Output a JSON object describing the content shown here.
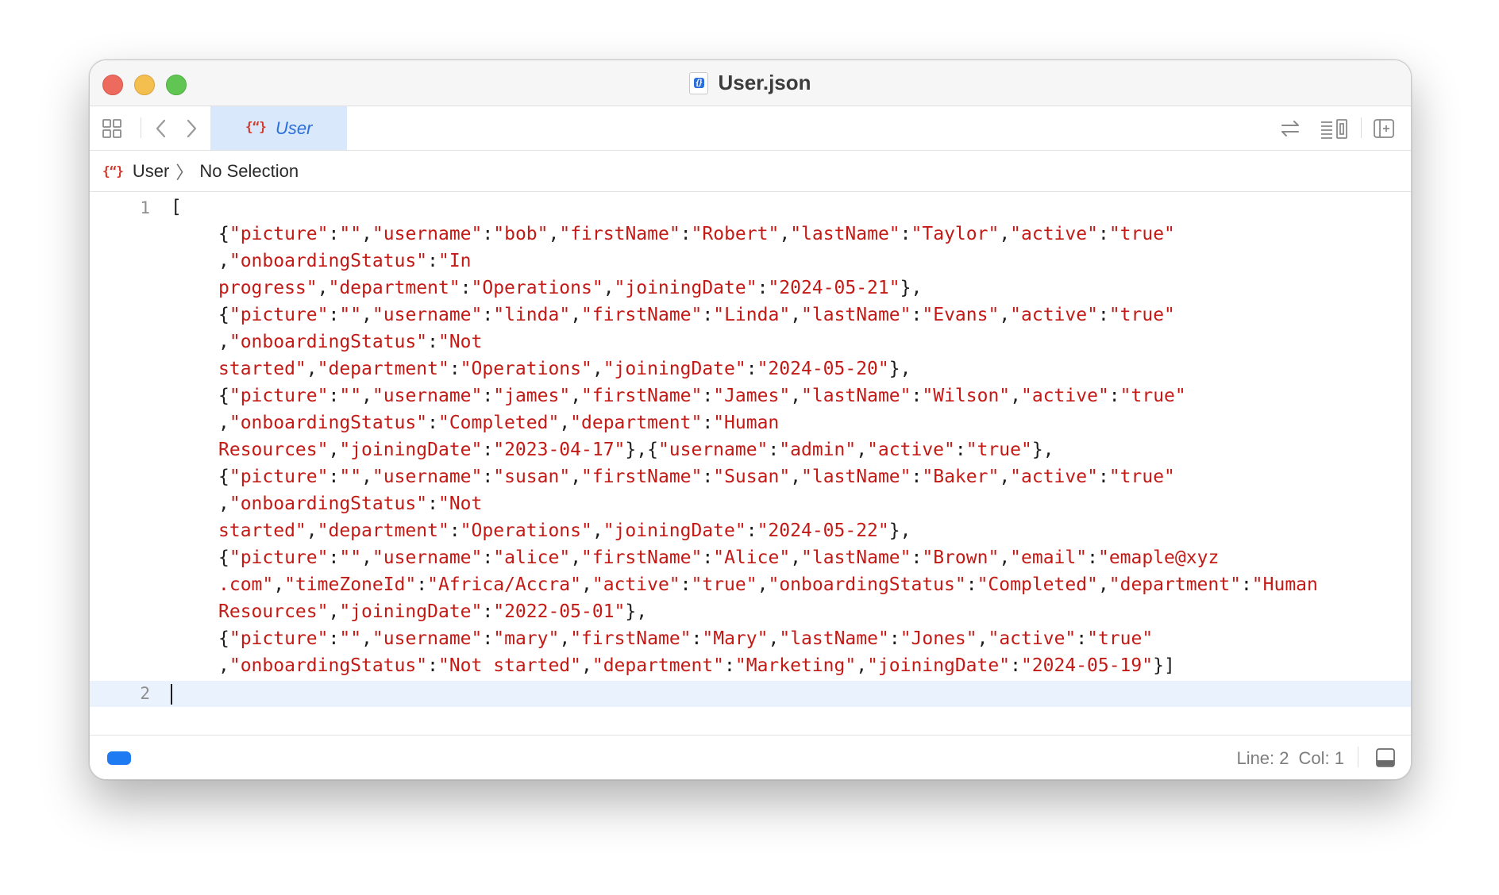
{
  "window": {
    "title": "User.json",
    "file_icon": "json-file-icon"
  },
  "toolbar": {
    "tab_label": "User",
    "tab_icon": "json-curly-icon",
    "icons": [
      "grid-icon",
      "back-arrow-icon",
      "forward-arrow-icon",
      "swap-arrows-icon",
      "minimap-icon",
      "add-editor-icon"
    ]
  },
  "jumpbar": {
    "file": "User",
    "selection": "No Selection"
  },
  "editor": {
    "line_numbers": [
      "1",
      "2"
    ],
    "lines": [
      [
        [
          "p",
          "["
        ]
      ],
      [
        [
          "p",
          "{"
        ],
        [
          "s",
          "\"picture\""
        ],
        [
          "p",
          ":"
        ],
        [
          "s",
          "\"\""
        ],
        [
          "p",
          ","
        ],
        [
          "s",
          "\"username\""
        ],
        [
          "p",
          ":"
        ],
        [
          "s",
          "\"bob\""
        ],
        [
          "p",
          ","
        ],
        [
          "s",
          "\"firstName\""
        ],
        [
          "p",
          ":"
        ],
        [
          "s",
          "\"Robert\""
        ],
        [
          "p",
          ","
        ],
        [
          "s",
          "\"lastName\""
        ],
        [
          "p",
          ":"
        ],
        [
          "s",
          "\"Taylor\""
        ],
        [
          "p",
          ","
        ],
        [
          "s",
          "\"active\""
        ],
        [
          "p",
          ":"
        ],
        [
          "s",
          "\"true\""
        ]
      ],
      [
        [
          "p",
          ","
        ],
        [
          "s",
          "\"onboardingStatus\""
        ],
        [
          "p",
          ":"
        ],
        [
          "s",
          "\"In"
        ]
      ],
      [
        [
          "s",
          "progress\""
        ],
        [
          "p",
          ","
        ],
        [
          "s",
          "\"department\""
        ],
        [
          "p",
          ":"
        ],
        [
          "s",
          "\"Operations\""
        ],
        [
          "p",
          ","
        ],
        [
          "s",
          "\"joiningDate\""
        ],
        [
          "p",
          ":"
        ],
        [
          "s",
          "\"2024-05-21\""
        ],
        [
          "p",
          "},"
        ]
      ],
      [
        [
          "p",
          "{"
        ],
        [
          "s",
          "\"picture\""
        ],
        [
          "p",
          ":"
        ],
        [
          "s",
          "\"\""
        ],
        [
          "p",
          ","
        ],
        [
          "s",
          "\"username\""
        ],
        [
          "p",
          ":"
        ],
        [
          "s",
          "\"linda\""
        ],
        [
          "p",
          ","
        ],
        [
          "s",
          "\"firstName\""
        ],
        [
          "p",
          ":"
        ],
        [
          "s",
          "\"Linda\""
        ],
        [
          "p",
          ","
        ],
        [
          "s",
          "\"lastName\""
        ],
        [
          "p",
          ":"
        ],
        [
          "s",
          "\"Evans\""
        ],
        [
          "p",
          ","
        ],
        [
          "s",
          "\"active\""
        ],
        [
          "p",
          ":"
        ],
        [
          "s",
          "\"true\""
        ]
      ],
      [
        [
          "p",
          ","
        ],
        [
          "s",
          "\"onboardingStatus\""
        ],
        [
          "p",
          ":"
        ],
        [
          "s",
          "\"Not"
        ]
      ],
      [
        [
          "s",
          "started\""
        ],
        [
          "p",
          ","
        ],
        [
          "s",
          "\"department\""
        ],
        [
          "p",
          ":"
        ],
        [
          "s",
          "\"Operations\""
        ],
        [
          "p",
          ","
        ],
        [
          "s",
          "\"joiningDate\""
        ],
        [
          "p",
          ":"
        ],
        [
          "s",
          "\"2024-05-20\""
        ],
        [
          "p",
          "},"
        ]
      ],
      [
        [
          "p",
          "{"
        ],
        [
          "s",
          "\"picture\""
        ],
        [
          "p",
          ":"
        ],
        [
          "s",
          "\"\""
        ],
        [
          "p",
          ","
        ],
        [
          "s",
          "\"username\""
        ],
        [
          "p",
          ":"
        ],
        [
          "s",
          "\"james\""
        ],
        [
          "p",
          ","
        ],
        [
          "s",
          "\"firstName\""
        ],
        [
          "p",
          ":"
        ],
        [
          "s",
          "\"James\""
        ],
        [
          "p",
          ","
        ],
        [
          "s",
          "\"lastName\""
        ],
        [
          "p",
          ":"
        ],
        [
          "s",
          "\"Wilson\""
        ],
        [
          "p",
          ","
        ],
        [
          "s",
          "\"active\""
        ],
        [
          "p",
          ":"
        ],
        [
          "s",
          "\"true\""
        ]
      ],
      [
        [
          "p",
          ","
        ],
        [
          "s",
          "\"onboardingStatus\""
        ],
        [
          "p",
          ":"
        ],
        [
          "s",
          "\"Completed\""
        ],
        [
          "p",
          ","
        ],
        [
          "s",
          "\"department\""
        ],
        [
          "p",
          ":"
        ],
        [
          "s",
          "\"Human"
        ]
      ],
      [
        [
          "s",
          "Resources\""
        ],
        [
          "p",
          ","
        ],
        [
          "s",
          "\"joiningDate\""
        ],
        [
          "p",
          ":"
        ],
        [
          "s",
          "\"2023-04-17\""
        ],
        [
          "p",
          "},{"
        ],
        [
          "s",
          "\"username\""
        ],
        [
          "p",
          ":"
        ],
        [
          "s",
          "\"admin\""
        ],
        [
          "p",
          ","
        ],
        [
          "s",
          "\"active\""
        ],
        [
          "p",
          ":"
        ],
        [
          "s",
          "\"true\""
        ],
        [
          "p",
          "},"
        ]
      ],
      [
        [
          "p",
          "{"
        ],
        [
          "s",
          "\"picture\""
        ],
        [
          "p",
          ":"
        ],
        [
          "s",
          "\"\""
        ],
        [
          "p",
          ","
        ],
        [
          "s",
          "\"username\""
        ],
        [
          "p",
          ":"
        ],
        [
          "s",
          "\"susan\""
        ],
        [
          "p",
          ","
        ],
        [
          "s",
          "\"firstName\""
        ],
        [
          "p",
          ":"
        ],
        [
          "s",
          "\"Susan\""
        ],
        [
          "p",
          ","
        ],
        [
          "s",
          "\"lastName\""
        ],
        [
          "p",
          ":"
        ],
        [
          "s",
          "\"Baker\""
        ],
        [
          "p",
          ","
        ],
        [
          "s",
          "\"active\""
        ],
        [
          "p",
          ":"
        ],
        [
          "s",
          "\"true\""
        ]
      ],
      [
        [
          "p",
          ","
        ],
        [
          "s",
          "\"onboardingStatus\""
        ],
        [
          "p",
          ":"
        ],
        [
          "s",
          "\"Not"
        ]
      ],
      [
        [
          "s",
          "started\""
        ],
        [
          "p",
          ","
        ],
        [
          "s",
          "\"department\""
        ],
        [
          "p",
          ":"
        ],
        [
          "s",
          "\"Operations\""
        ],
        [
          "p",
          ","
        ],
        [
          "s",
          "\"joiningDate\""
        ],
        [
          "p",
          ":"
        ],
        [
          "s",
          "\"2024-05-22\""
        ],
        [
          "p",
          "},"
        ]
      ],
      [
        [
          "p",
          "{"
        ],
        [
          "s",
          "\"picture\""
        ],
        [
          "p",
          ":"
        ],
        [
          "s",
          "\"\""
        ],
        [
          "p",
          ","
        ],
        [
          "s",
          "\"username\""
        ],
        [
          "p",
          ":"
        ],
        [
          "s",
          "\"alice\""
        ],
        [
          "p",
          ","
        ],
        [
          "s",
          "\"firstName\""
        ],
        [
          "p",
          ":"
        ],
        [
          "s",
          "\"Alice\""
        ],
        [
          "p",
          ","
        ],
        [
          "s",
          "\"lastName\""
        ],
        [
          "p",
          ":"
        ],
        [
          "s",
          "\"Brown\""
        ],
        [
          "p",
          ","
        ],
        [
          "s",
          "\"email\""
        ],
        [
          "p",
          ":"
        ],
        [
          "s",
          "\"emaple@xyz"
        ]
      ],
      [
        [
          "s",
          ".com\""
        ],
        [
          "p",
          ","
        ],
        [
          "s",
          "\"timeZoneId\""
        ],
        [
          "p",
          ":"
        ],
        [
          "s",
          "\"Africa/Accra\""
        ],
        [
          "p",
          ","
        ],
        [
          "s",
          "\"active\""
        ],
        [
          "p",
          ":"
        ],
        [
          "s",
          "\"true\""
        ],
        [
          "p",
          ","
        ],
        [
          "s",
          "\"onboardingStatus\""
        ],
        [
          "p",
          ":"
        ],
        [
          "s",
          "\"Completed\""
        ],
        [
          "p",
          ","
        ],
        [
          "s",
          "\"department\""
        ],
        [
          "p",
          ":"
        ],
        [
          "s",
          "\"Human"
        ]
      ],
      [
        [
          "s",
          "Resources\""
        ],
        [
          "p",
          ","
        ],
        [
          "s",
          "\"joiningDate\""
        ],
        [
          "p",
          ":"
        ],
        [
          "s",
          "\"2022-05-01\""
        ],
        [
          "p",
          "},"
        ]
      ],
      [
        [
          "p",
          "{"
        ],
        [
          "s",
          "\"picture\""
        ],
        [
          "p",
          ":"
        ],
        [
          "s",
          "\"\""
        ],
        [
          "p",
          ","
        ],
        [
          "s",
          "\"username\""
        ],
        [
          "p",
          ":"
        ],
        [
          "s",
          "\"mary\""
        ],
        [
          "p",
          ","
        ],
        [
          "s",
          "\"firstName\""
        ],
        [
          "p",
          ":"
        ],
        [
          "s",
          "\"Mary\""
        ],
        [
          "p",
          ","
        ],
        [
          "s",
          "\"lastName\""
        ],
        [
          "p",
          ":"
        ],
        [
          "s",
          "\"Jones\""
        ],
        [
          "p",
          ","
        ],
        [
          "s",
          "\"active\""
        ],
        [
          "p",
          ":"
        ],
        [
          "s",
          "\"true\""
        ]
      ],
      [
        [
          "p",
          ","
        ],
        [
          "s",
          "\"onboardingStatus\""
        ],
        [
          "p",
          ":"
        ],
        [
          "s",
          "\"Not started\""
        ],
        [
          "p",
          ","
        ],
        [
          "s",
          "\"department\""
        ],
        [
          "p",
          ":"
        ],
        [
          "s",
          "\"Marketing\""
        ],
        [
          "p",
          ","
        ],
        [
          "s",
          "\"joiningDate\""
        ],
        [
          "p",
          ":"
        ],
        [
          "s",
          "\"2024-05-19\""
        ],
        [
          "p",
          "}]"
        ]
      ]
    ]
  },
  "status": {
    "line": "Line: 2",
    "col": "Col: 1"
  },
  "colors": {
    "string": "#c41a16",
    "accent": "#2a6fdb",
    "current_line": "#eaf2fd"
  }
}
